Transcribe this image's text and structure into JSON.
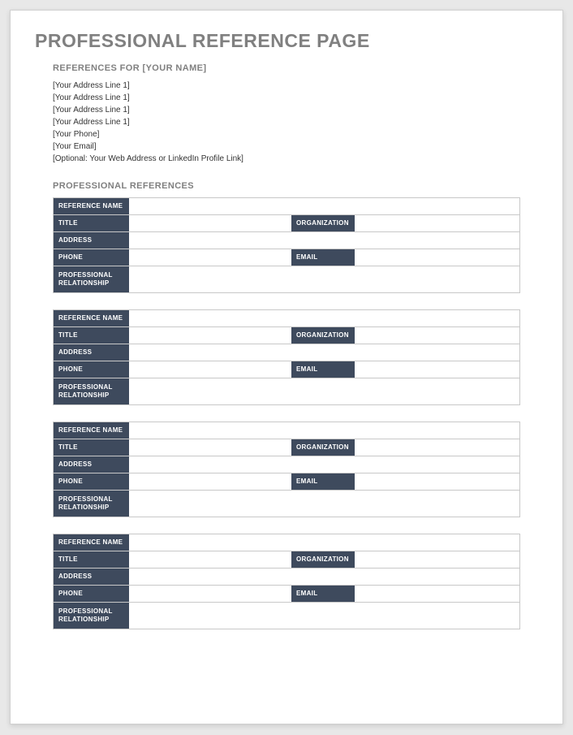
{
  "title": "PROFESSIONAL REFERENCE PAGE",
  "subtitle": "REFERENCES FOR [YOUR NAME]",
  "address_lines": [
    "[Your Address Line 1]",
    "[Your Address Line 1]",
    "[Your Address Line 1]",
    "[Your Address Line 1]",
    "[Your Phone]",
    "[Your Email]",
    "[Optional: Your Web Address or LinkedIn Profile Link]"
  ],
  "section_title": "PROFESSIONAL REFERENCES",
  "labels": {
    "reference_name": "REFERENCE NAME",
    "title": "TITLE",
    "organization": "ORGANIZATION",
    "address": "ADDRESS",
    "phone": "PHONE",
    "email": "EMAIL",
    "professional_relationship": "PROFESSIONAL RELATIONSHIP"
  },
  "references": [
    {
      "reference_name": "",
      "title": "",
      "organization": "",
      "address": "",
      "phone": "",
      "email": "",
      "professional_relationship": ""
    },
    {
      "reference_name": "",
      "title": "",
      "organization": "",
      "address": "",
      "phone": "",
      "email": "",
      "professional_relationship": ""
    },
    {
      "reference_name": "",
      "title": "",
      "organization": "",
      "address": "",
      "phone": "",
      "email": "",
      "professional_relationship": ""
    },
    {
      "reference_name": "",
      "title": "",
      "organization": "",
      "address": "",
      "phone": "",
      "email": "",
      "professional_relationship": ""
    }
  ]
}
